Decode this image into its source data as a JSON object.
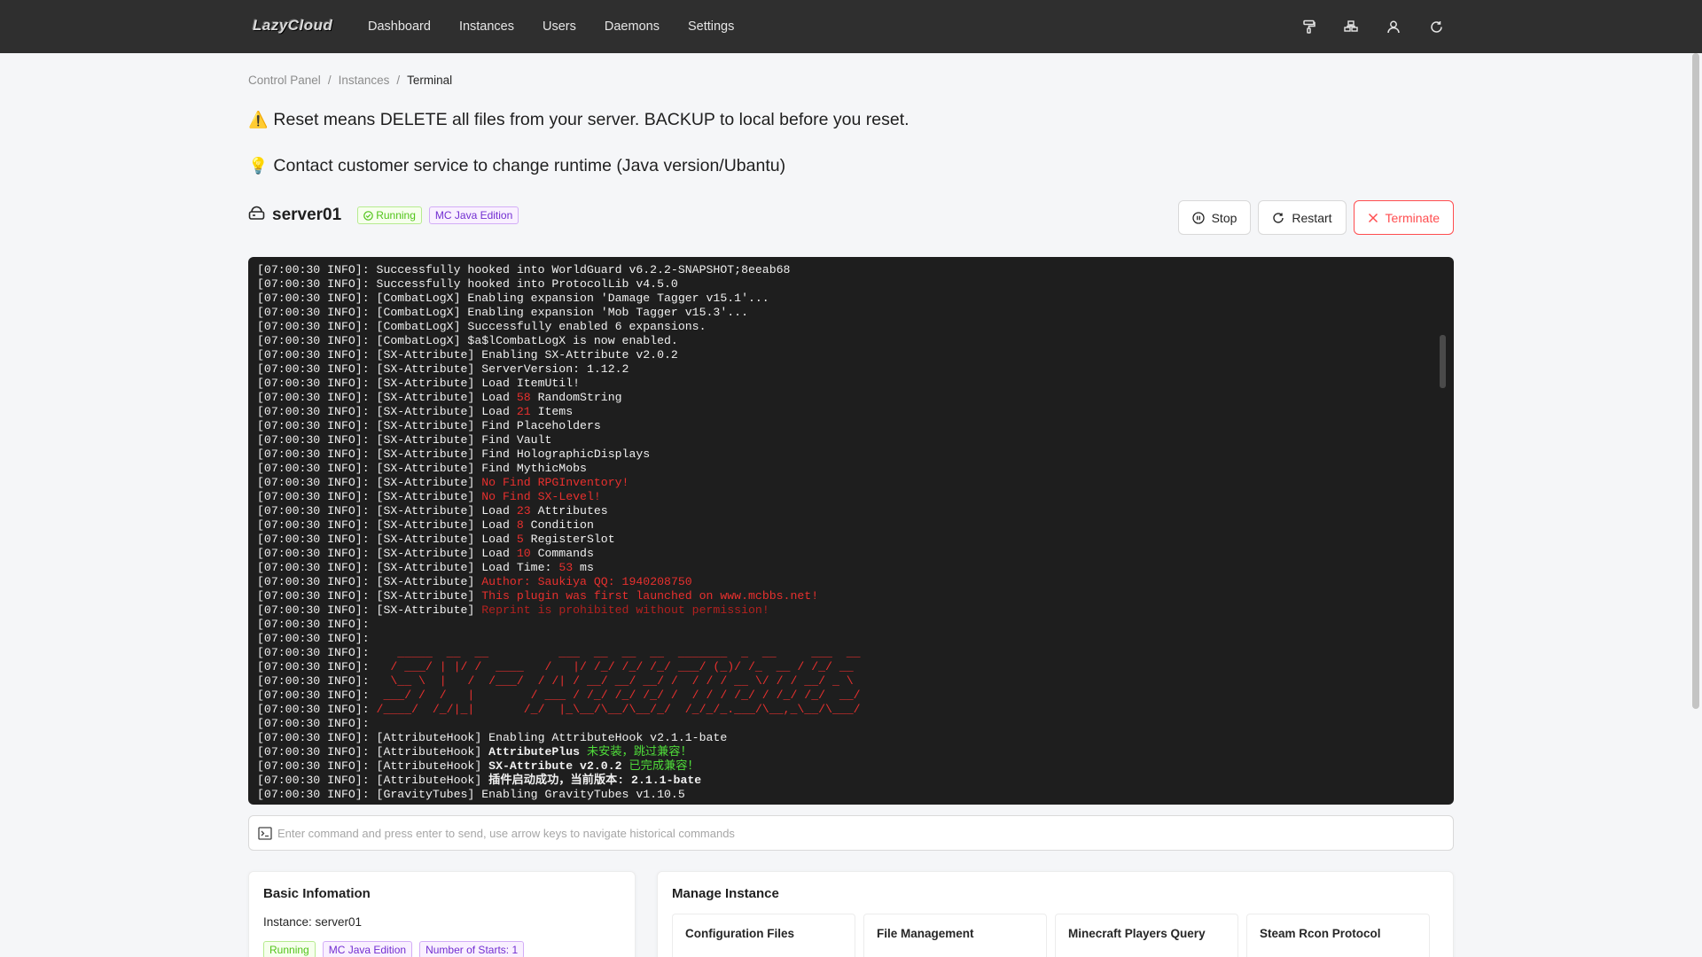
{
  "app": {
    "logo": "LazyCloud"
  },
  "nav": [
    {
      "id": "dashboard",
      "label": "Dashboard"
    },
    {
      "id": "instances",
      "label": "Instances"
    },
    {
      "id": "users",
      "label": "Users"
    },
    {
      "id": "daemons",
      "label": "Daemons"
    },
    {
      "id": "settings",
      "label": "Settings"
    }
  ],
  "top_icons": [
    "paint-roller-icon",
    "cluster-icon",
    "user-icon",
    "refresh-icon"
  ],
  "breadcrumb": {
    "items": [
      "Control Panel",
      "Instances",
      "Terminal"
    ],
    "separator": "/"
  },
  "notices": [
    {
      "icon": "⚠️",
      "text": "Reset means DELETE all files from your server. BACKUP to local before you reset."
    },
    {
      "icon": "💡",
      "text": "Contact customer service to change runtime (Java version/Ubantu)"
    }
  ],
  "instance": {
    "name": "server01",
    "status": "Running",
    "type": "MC Java Edition"
  },
  "actions": {
    "stop": "Stop",
    "restart": "Restart",
    "terminate": "Terminate"
  },
  "terminal": {
    "prefix": "[07:00:30 INFO]: ",
    "lines": [
      [
        [
          "",
          "Successfully hooked into WorldGuard v6.2.2-SNAPSHOT;8eeab68"
        ]
      ],
      [
        [
          "",
          "Successfully hooked into ProtocolLib v4.5.0"
        ]
      ],
      [
        [
          "",
          "[CombatLogX] Enabling expansion 'Damage Tagger v15.1'..."
        ]
      ],
      [
        [
          "",
          "[CombatLogX] Enabling expansion 'Mob Tagger v15.3'..."
        ]
      ],
      [
        [
          "",
          "[CombatLogX] Successfully enabled 6 expansions."
        ]
      ],
      [
        [
          "",
          "[CombatLogX] $a$lCombatLogX is now enabled."
        ]
      ],
      [
        [
          "",
          "[SX-Attribute] Enabling SX-Attribute v2.0.2"
        ]
      ],
      [
        [
          "",
          "[SX-Attribute] ServerVersion: 1.12.2"
        ]
      ],
      [
        [
          "",
          "[SX-Attribute] Load ItemUtil!"
        ]
      ],
      [
        [
          "",
          "[SX-Attribute] Load "
        ],
        [
          "r",
          "58"
        ],
        [
          "",
          " RandomString"
        ]
      ],
      [
        [
          "",
          "[SX-Attribute] Load "
        ],
        [
          "r",
          "21"
        ],
        [
          "",
          " Items"
        ]
      ],
      [
        [
          "",
          "[SX-Attribute] Find Placeholders"
        ]
      ],
      [
        [
          "",
          "[SX-Attribute] Find Vault"
        ]
      ],
      [
        [
          "",
          "[SX-Attribute] Find HolographicDisplays"
        ]
      ],
      [
        [
          "",
          "[SX-Attribute] Find MythicMobs"
        ]
      ],
      [
        [
          "",
          "[SX-Attribute] "
        ],
        [
          "r",
          "No Find RPGInventory!"
        ]
      ],
      [
        [
          "",
          "[SX-Attribute] "
        ],
        [
          "r",
          "No Find SX-Level!"
        ]
      ],
      [
        [
          "",
          "[SX-Attribute] Load "
        ],
        [
          "r",
          "23"
        ],
        [
          "",
          " Attributes"
        ]
      ],
      [
        [
          "",
          "[SX-Attribute] Load "
        ],
        [
          "r",
          "8"
        ],
        [
          "",
          " Condition"
        ]
      ],
      [
        [
          "",
          "[SX-Attribute] Load "
        ],
        [
          "r",
          "5"
        ],
        [
          "",
          " RegisterSlot"
        ]
      ],
      [
        [
          "",
          "[SX-Attribute] Load "
        ],
        [
          "r",
          "10"
        ],
        [
          "",
          " Commands"
        ]
      ],
      [
        [
          "",
          "[SX-Attribute] Load Time: "
        ],
        [
          "r",
          "53"
        ],
        [
          "",
          " ms"
        ]
      ],
      [
        [
          "",
          "[SX-Attribute] "
        ],
        [
          "r",
          "Author: Saukiya QQ: 1940208750"
        ]
      ],
      [
        [
          "",
          "[SX-Attribute] "
        ],
        [
          "r",
          "This plugin was first launched on www.mcbbs.net!"
        ]
      ],
      [
        [
          "",
          "[SX-Attribute] "
        ],
        [
          "dr",
          "Reprint is prohibited without permission!"
        ]
      ],
      [
        [
          "",
          ""
        ]
      ],
      [
        [
          "",
          ""
        ]
      ],
      [
        [
          "r",
          "   _____  __  __          ___  __  __  __  _______  _  __     ___  __"
        ]
      ],
      [
        [
          "r",
          "  / ___/ | |/ /  ____   /   |/ /_/ /_/ /_/ ___/ (_)/ /_  __ / /_/ __"
        ]
      ],
      [
        [
          "r",
          "  \\__ \\  |   /  /___/  / /| / __/ __/ __/ /  / / / __ \\/ / / __/ _ \\"
        ]
      ],
      [
        [
          "r",
          " ___/ /  /   |        / ___ / /_/ /_/ /_/ /  / / / /_/ / /_/ /_/  __/"
        ]
      ],
      [
        [
          "r",
          "/____/  /_/|_|       /_/  |_\\__/\\__/\\__/_/  /_/_/_.___/\\__,_\\__/\\___/"
        ]
      ],
      [
        [
          "",
          ""
        ]
      ],
      [
        [
          "",
          "[AttributeHook] Enabling AttributeHook v2.1.1-bate"
        ]
      ],
      [
        [
          "",
          "[AttributeHook] "
        ],
        [
          "b",
          "AttributePlus "
        ],
        [
          "g",
          "未安装，跳过兼容！"
        ]
      ],
      [
        [
          "",
          "[AttributeHook] "
        ],
        [
          "b",
          "SX-Attribute v2.0.2 "
        ],
        [
          "g",
          "已完成兼容！"
        ]
      ],
      [
        [
          "",
          "[AttributeHook] "
        ],
        [
          "b",
          "插件启动成功，当前版本: 2.1.1-bate"
        ]
      ],
      [
        [
          "",
          "[GravityTubes] Enabling GravityTubes v1.10.5"
        ]
      ]
    ]
  },
  "command": {
    "placeholder": "Enter command and press enter to send, use arrow keys to navigate historical commands"
  },
  "basic": {
    "title": "Basic Infomation",
    "instance_line": "Instance: server01",
    "tags": [
      "Running",
      "MC Java Edition",
      "Number of Starts: 1"
    ]
  },
  "manage": {
    "title": "Manage Instance",
    "tiles": [
      "Configuration Files",
      "File Management",
      "Minecraft Players Query",
      "Steam Rcon Protocol"
    ]
  }
}
